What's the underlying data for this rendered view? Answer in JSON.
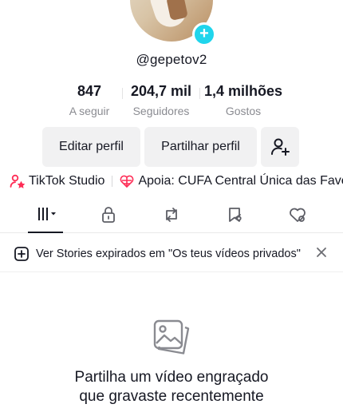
{
  "profile": {
    "username": "@gepetov2",
    "avatar_badge": "+"
  },
  "stats": [
    {
      "value": "847",
      "label": "A seguir"
    },
    {
      "value": "204,7 mil",
      "label": "Seguidores"
    },
    {
      "value": "1,4 milhões",
      "label": "Gostos"
    }
  ],
  "actions": {
    "edit_label": "Editar perfil",
    "share_label": "Partilhar perfil",
    "add_friend_icon": "add-person-icon"
  },
  "links": [
    {
      "icon": "studio-icon",
      "label": "TikTok Studio"
    },
    {
      "icon": "heart-globe-icon",
      "label": "Apoia: CUFA Central Única das Fave"
    }
  ],
  "tabs": [
    {
      "icon": "grid-icon",
      "selected": true
    },
    {
      "icon": "lock-icon",
      "selected": false
    },
    {
      "icon": "repost-icon",
      "selected": false
    },
    {
      "icon": "bookmark-icon",
      "selected": false
    },
    {
      "icon": "liked-hidden-icon",
      "selected": false
    }
  ],
  "notice": {
    "text": "Ver Stories expirados em \"Os teus vídeos privados\"",
    "icon": "story-plus-icon",
    "close_icon": "close-icon"
  },
  "empty_state": {
    "icon": "photos-icon",
    "line1": "Partilha um vídeo engraçado",
    "line2": "que gravaste recentemente"
  },
  "colors": {
    "accent": "#20d5ec",
    "studio_red": "#fe2c55",
    "text": "#161823",
    "muted": "#8a8b91",
    "button_bg": "#f1f1f2"
  }
}
